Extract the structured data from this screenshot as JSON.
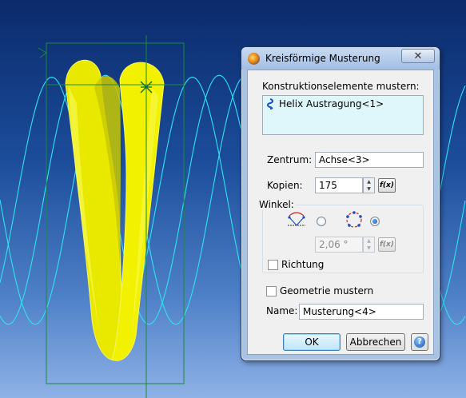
{
  "dialog": {
    "title": "Kreisförmige Musterung",
    "close_symbol": "✕",
    "elements_label": "Konstruktionselemente mustern:",
    "elements": [
      {
        "label": "Helix Austragung<1>",
        "icon": "helix-icon"
      }
    ],
    "center_label": "Zentrum:",
    "center_value": "Achse<3>",
    "copies_label": "Kopien:",
    "copies_value": "175",
    "fx_label": "f(x)",
    "angle_group_label": "Winkel:",
    "angle_mode_options": [
      {
        "icon": "angle-between-copies-icon",
        "selected": false
      },
      {
        "icon": "full-circle-distribution-icon",
        "selected": true
      }
    ],
    "angle_value": "2,06 °",
    "direction_label": "Richtung",
    "direction_checked": false,
    "pattern_geometry_label": "Geometrie mustern",
    "pattern_geometry_checked": false,
    "name_label": "Name:",
    "name_value": "Musterung<4>",
    "ok_label": "OK",
    "cancel_label": "Abbrechen",
    "help_symbol": "?"
  },
  "viewport": {
    "background_top": "#0b2a6b",
    "background_bottom": "#8fb2e6",
    "helix_color": "#2fe3f0",
    "surface_color": "#f2f200",
    "bbox_color": "#1b8a3a"
  }
}
